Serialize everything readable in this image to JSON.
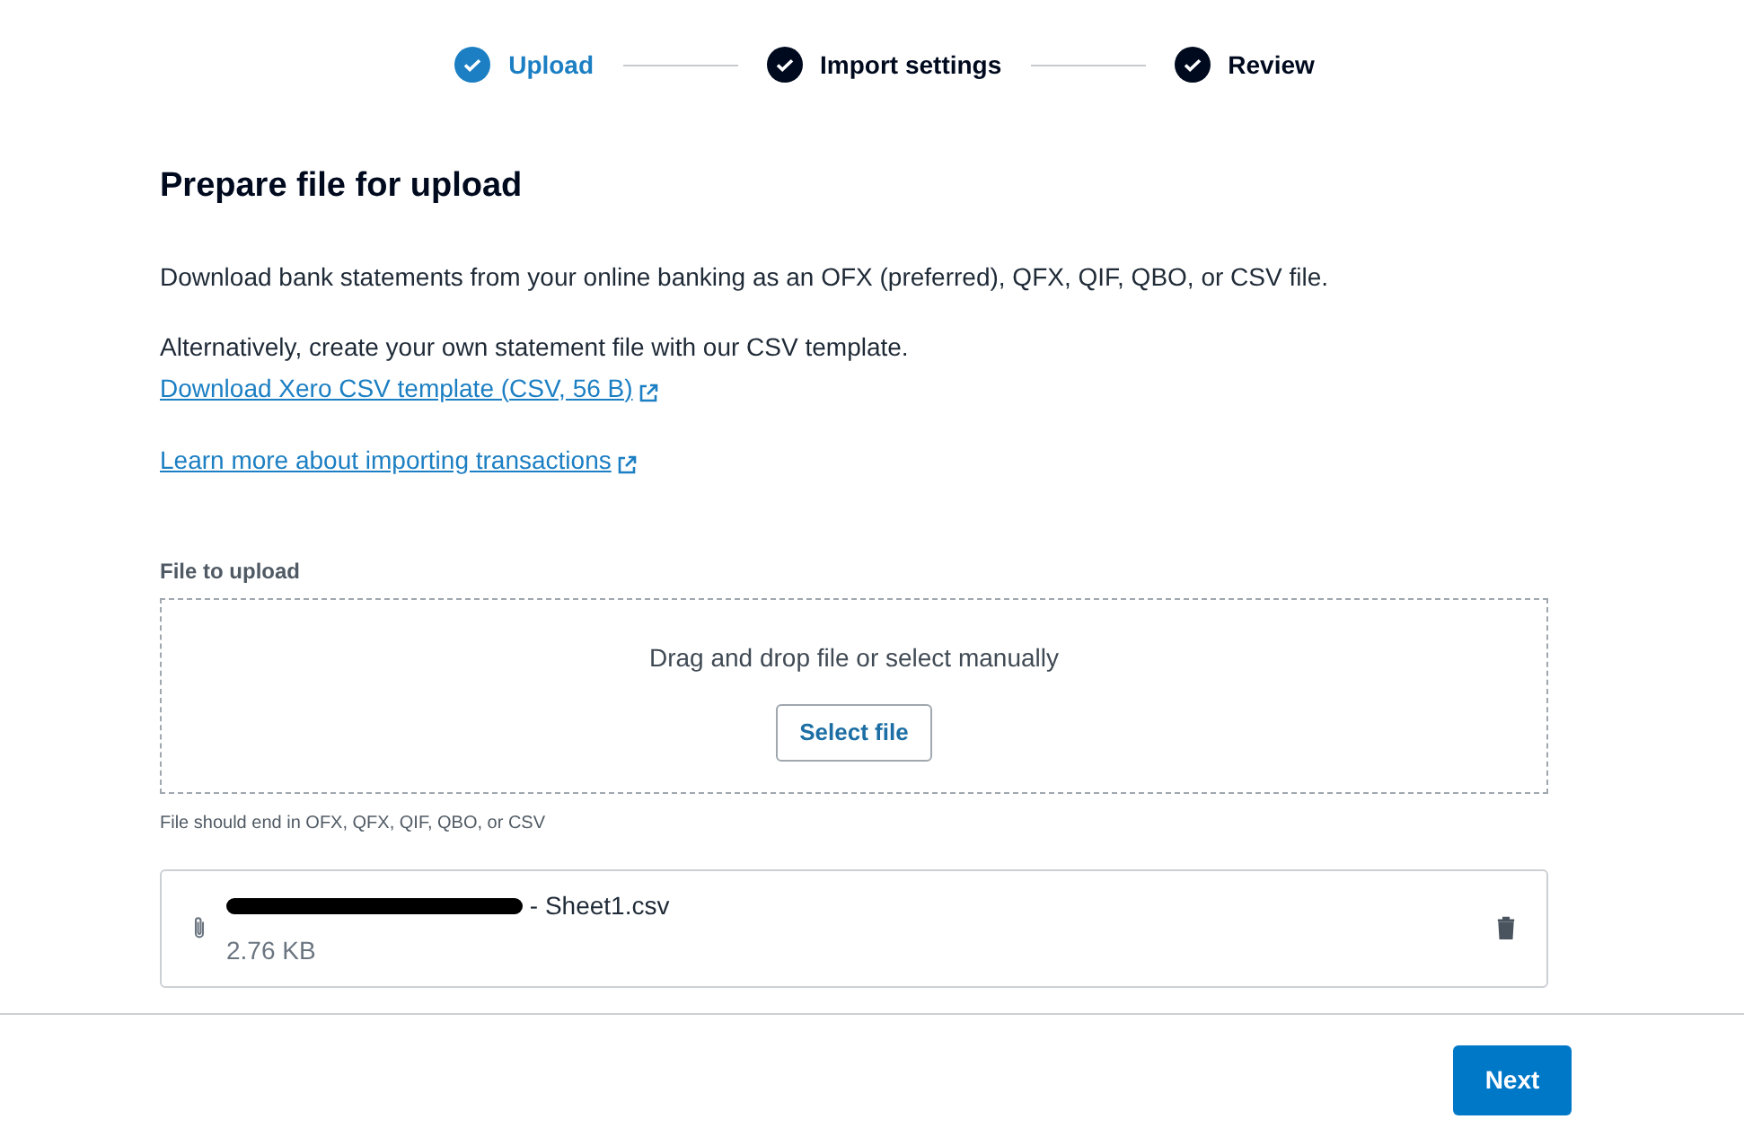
{
  "steps": [
    {
      "label": "Upload",
      "selected": true
    },
    {
      "label": "Import settings",
      "selected": false
    },
    {
      "label": "Review",
      "selected": false
    }
  ],
  "heading": "Prepare file for upload",
  "intro": "Download bank statements from your online banking as an OFX (preferred), QFX, QIF, QBO, or CSV file.",
  "alternative": "Alternatively, create your own statement file with our CSV template.",
  "links": [
    "Download Xero CSV template (CSV, 56 B)",
    "Learn more about importing transactions"
  ],
  "upload": {
    "label": "File to upload",
    "drop_text": "Drag and drop file or select manually",
    "button": "Select file",
    "hint": "File should end in OFX, QFX, QIF, QBO, or CSV"
  },
  "file": {
    "name": "- Sheet1.csv",
    "size": "2.76 KB",
    "redacted": true
  },
  "footer": {
    "button": "Next"
  }
}
